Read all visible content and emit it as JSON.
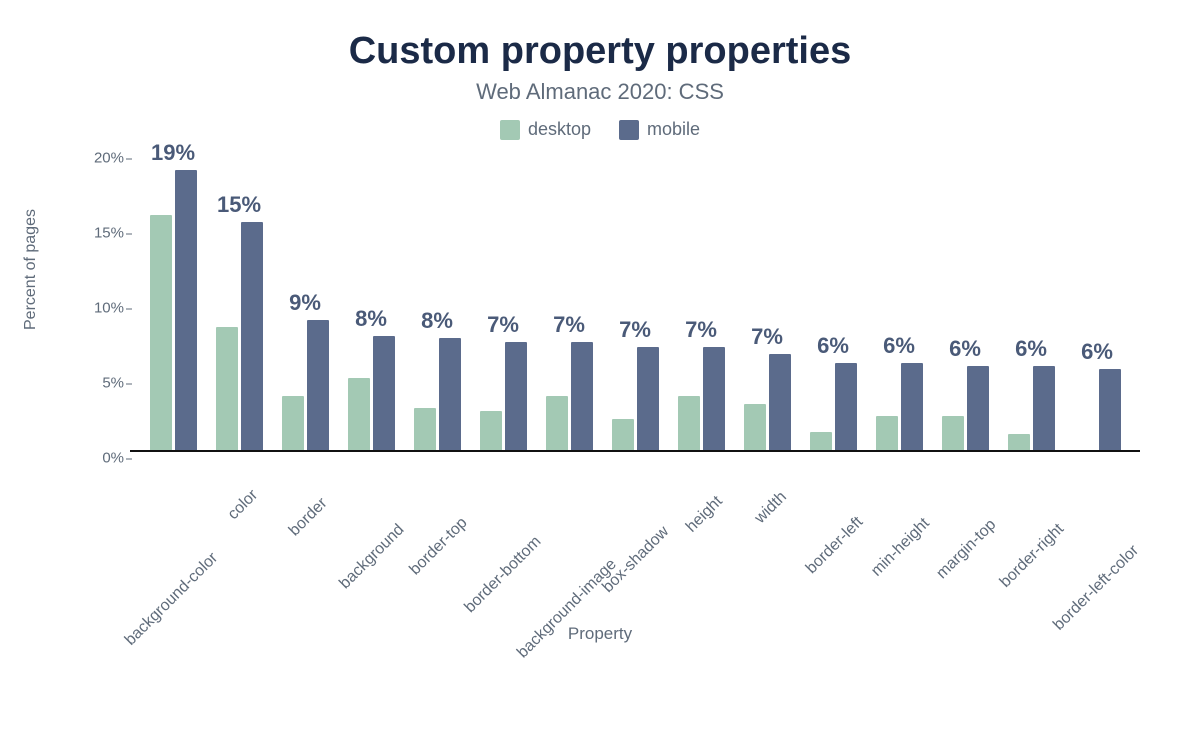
{
  "chart_data": {
    "type": "bar",
    "title": "Custom property properties",
    "subtitle": "Web Almanac 2020: CSS",
    "xlabel": "Property",
    "ylabel": "Percent of pages",
    "ylim": [
      0,
      20
    ],
    "y_ticks": [
      0,
      5,
      10,
      15,
      20
    ],
    "y_tick_labels": [
      "0%",
      "5%",
      "10%",
      "15%",
      "20%"
    ],
    "legend": [
      {
        "name": "desktop",
        "color": "#a3c9b4"
      },
      {
        "name": "mobile",
        "color": "#5b6b8c"
      }
    ],
    "categories": [
      "background-color",
      "color",
      "border",
      "background",
      "border-top",
      "border-bottom",
      "background-image",
      "box-shadow",
      "height",
      "width",
      "border-left",
      "min-height",
      "margin-top",
      "border-right",
      "border-left-color"
    ],
    "series": [
      {
        "name": "desktop",
        "color": "#a3c9b4",
        "values": [
          15.7,
          8.2,
          3.6,
          4.8,
          2.8,
          2.6,
          3.6,
          2.1,
          3.6,
          3.1,
          1.2,
          2.3,
          2.3,
          1.1,
          0.0
        ]
      },
      {
        "name": "mobile",
        "color": "#5b6b8c",
        "values": [
          18.7,
          15.2,
          8.7,
          7.6,
          7.5,
          7.2,
          7.2,
          6.9,
          6.9,
          6.4,
          5.8,
          5.8,
          5.6,
          5.6,
          5.4
        ]
      }
    ],
    "value_labels": [
      "19%",
      "15%",
      "9%",
      "8%",
      "8%",
      "7%",
      "7%",
      "7%",
      "7%",
      "7%",
      "6%",
      "6%",
      "6%",
      "6%",
      "6%"
    ]
  }
}
